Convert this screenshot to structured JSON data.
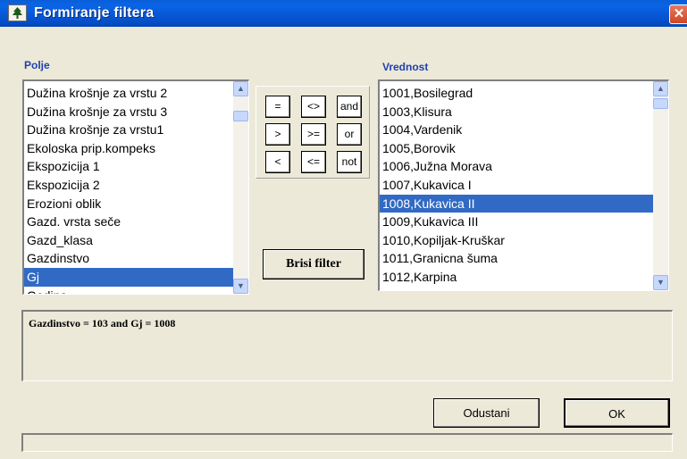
{
  "window": {
    "title": "Formiranje filtera",
    "close_glyph": "✕"
  },
  "left_panel": {
    "label": "Polje",
    "items": [
      {
        "text": "Dužina krošnje za vrstu 2",
        "selected": false
      },
      {
        "text": "Dužina krošnje za vrstu 3",
        "selected": false
      },
      {
        "text": "Dužina krošnje za vrstu1",
        "selected": false
      },
      {
        "text": "Ekoloska prip.kompeks",
        "selected": false
      },
      {
        "text": "Ekspozicija 1",
        "selected": false
      },
      {
        "text": "Ekspozicija 2",
        "selected": false
      },
      {
        "text": "Erozioni oblik",
        "selected": false
      },
      {
        "text": "Gazd. vrsta seče",
        "selected": false
      },
      {
        "text": "Gazd_klasa",
        "selected": false
      },
      {
        "text": "Gazdinstvo",
        "selected": false
      },
      {
        "text": "Gj",
        "selected": true
      },
      {
        "text": "Godina",
        "selected": false
      }
    ]
  },
  "right_panel": {
    "label": "Vrednost",
    "items": [
      {
        "text": "1001,Bosilegrad",
        "selected": false
      },
      {
        "text": "1003,Klisura",
        "selected": false
      },
      {
        "text": "1004,Vardenik",
        "selected": false
      },
      {
        "text": "1005,Borovik",
        "selected": false
      },
      {
        "text": "1006,Južna Morava",
        "selected": false
      },
      {
        "text": "1007,Kukavica I",
        "selected": false
      },
      {
        "text": "1008,Kukavica II",
        "selected": true
      },
      {
        "text": "1009,Kukavica III",
        "selected": false
      },
      {
        "text": "1010,Kopiljak-Kruškar",
        "selected": false
      },
      {
        "text": "1011,Granicna šuma",
        "selected": false
      },
      {
        "text": "1012,Karpina",
        "selected": false
      }
    ]
  },
  "operators": [
    "=",
    "<>",
    "and",
    ">",
    ">=",
    "or",
    "<",
    "<=",
    "not"
  ],
  "buttons": {
    "clear_filter": "Brisi  filter",
    "cancel": "Odustani",
    "ok": "OK"
  },
  "filter_expression": "Gazdinstvo = 103 and Gj = 1008",
  "icons": {
    "scroll_up": "▲",
    "scroll_down": "▼",
    "app": "tree-icon"
  },
  "colors": {
    "title_bar": "#0a5ed8",
    "selection": "#316ac5",
    "label": "#2040b0",
    "close_button": "#d14520"
  }
}
